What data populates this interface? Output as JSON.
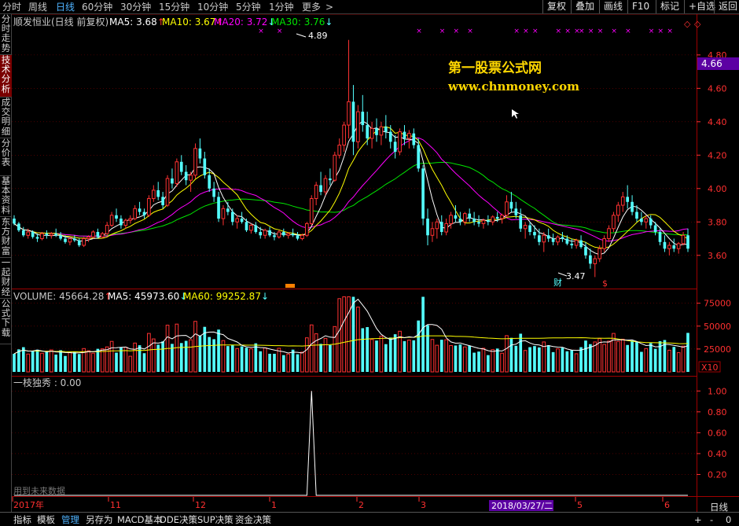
{
  "toolbar": {
    "period_tabs": [
      "分时",
      "周线",
      "日线",
      "60分钟",
      "30分钟",
      "15分钟",
      "10分钟",
      "5分钟",
      "1分钟",
      "更多"
    ],
    "more_arrow": ">",
    "active_period": "日线",
    "right_buttons": [
      "复权",
      "叠加",
      "画线",
      "F10",
      "标记",
      "+自选",
      "返回"
    ]
  },
  "left_tabs": [
    "分时走势",
    "技术分析",
    "成交明细",
    "分价表",
    "基本资料",
    "东方财富",
    "一起财经",
    "公式下载"
  ],
  "active_left_tab": "技术分析",
  "bottom_tabs": [
    "指标",
    "模板",
    "管理",
    "另存为",
    "MACD基本",
    "DDE决策",
    "SUP决策",
    "资金决策"
  ],
  "active_bottom_tab": "管理",
  "bottom_right_buttons": [
    "日线",
    "+",
    "-",
    "0"
  ],
  "watermark": {
    "line1": "第一股票公式网",
    "line2": "www.chnmoney.com"
  },
  "colors": {
    "up": "#ff3232",
    "down": "#54ffff",
    "ma5": "#ffffff",
    "ma10": "#ffff00",
    "ma20": "#ff00ff",
    "ma30": "#00e600",
    "grid": "#7a0000",
    "axis_text": "#ff3030",
    "highlight_label": "#5c00a3",
    "watermark": "#ffd700"
  },
  "main_panel": {
    "title": "顺发恒业(日线 前复权)",
    "ma_values": [
      {
        "name": "MA5",
        "value": "3.68",
        "arrow": "↑"
      },
      {
        "name": "MA10",
        "value": "3.67",
        "arrow": "↑"
      },
      {
        "name": "MA20",
        "value": "3.72",
        "arrow": "↓"
      },
      {
        "name": "MA30",
        "value": "3.76",
        "arrow": "↓"
      }
    ],
    "y_ticks": [
      "4.80",
      "4.60",
      "4.40",
      "4.20",
      "4.00",
      "3.80",
      "3.60"
    ],
    "current_price": "4.66",
    "max_label": "4.89",
    "min_label": "3.47",
    "marker_texts": [
      "财",
      "$"
    ]
  },
  "volume_panel": {
    "title": "VOLUME: 45664.28",
    "title_arrow": "↑",
    "ma5": "MA5: 45973.60",
    "ma5_arrow": "↓",
    "ma60": "MA60: 99252.87",
    "ma60_arrow": "↓",
    "y_ticks": [
      "75000",
      "50000",
      "25000"
    ],
    "multiplier": "X10"
  },
  "indicator_panel": {
    "title": "一枝独秀 : 0.00",
    "y_ticks": [
      "1.00",
      "0.80",
      "0.60",
      "0.40",
      "0.20"
    ],
    "footnote": "用到未来数据"
  },
  "time_axis": {
    "labels": [
      "2017年",
      "11",
      "12",
      "1",
      "2",
      "3",
      "2018/03/27/二",
      "5",
      "6"
    ],
    "highlight": "2018/03/27/二"
  },
  "chart_data": {
    "type": "candlestick",
    "title": "顺发恒业(日线 前复权)",
    "ylim": [
      3.42,
      4.95
    ],
    "bars": [
      [
        3.82,
        3.84,
        3.78,
        3.79
      ],
      [
        3.79,
        3.8,
        3.74,
        3.75
      ],
      [
        3.75,
        3.77,
        3.71,
        3.72
      ],
      [
        3.72,
        3.76,
        3.7,
        3.74
      ],
      [
        3.74,
        3.75,
        3.7,
        3.71
      ],
      [
        3.71,
        3.73,
        3.68,
        3.7
      ],
      [
        3.7,
        3.74,
        3.69,
        3.73
      ],
      [
        3.73,
        3.75,
        3.7,
        3.72
      ],
      [
        3.72,
        3.74,
        3.7,
        3.73
      ],
      [
        3.73,
        3.76,
        3.71,
        3.72
      ],
      [
        3.72,
        3.74,
        3.69,
        3.7
      ],
      [
        3.7,
        3.72,
        3.67,
        3.68
      ],
      [
        3.68,
        3.71,
        3.66,
        3.7
      ],
      [
        3.7,
        3.72,
        3.68,
        3.69
      ],
      [
        3.69,
        3.7,
        3.65,
        3.66
      ],
      [
        3.66,
        3.71,
        3.65,
        3.7
      ],
      [
        3.7,
        3.72,
        3.68,
        3.71
      ],
      [
        3.71,
        3.75,
        3.7,
        3.74
      ],
      [
        3.74,
        3.76,
        3.7,
        3.71
      ],
      [
        3.71,
        3.74,
        3.7,
        3.73
      ],
      [
        3.73,
        3.8,
        3.72,
        3.78
      ],
      [
        3.78,
        3.86,
        3.77,
        3.84
      ],
      [
        3.84,
        3.88,
        3.8,
        3.82
      ],
      [
        3.82,
        3.84,
        3.76,
        3.78
      ],
      [
        3.78,
        3.82,
        3.76,
        3.81
      ],
      [
        3.81,
        3.84,
        3.79,
        3.82
      ],
      [
        3.82,
        3.9,
        3.81,
        3.88
      ],
      [
        3.88,
        3.92,
        3.84,
        3.86
      ],
      [
        3.86,
        3.88,
        3.82,
        3.84
      ],
      [
        3.84,
        3.96,
        3.83,
        3.94
      ],
      [
        3.94,
        4.02,
        3.92,
        3.99
      ],
      [
        3.99,
        4.04,
        3.93,
        3.95
      ],
      [
        3.95,
        3.98,
        3.88,
        3.9
      ],
      [
        3.9,
        4.08,
        3.89,
        4.06
      ],
      [
        4.06,
        4.12,
        4.0,
        4.03
      ],
      [
        4.03,
        4.18,
        4.01,
        4.16
      ],
      [
        4.16,
        4.2,
        4.08,
        4.1
      ],
      [
        4.1,
        4.14,
        4.02,
        4.05
      ],
      [
        4.05,
        4.1,
        3.98,
        4.08
      ],
      [
        4.08,
        4.27,
        4.06,
        4.24
      ],
      [
        4.24,
        4.3,
        4.15,
        4.18
      ],
      [
        4.18,
        4.22,
        4.06,
        4.08
      ],
      [
        4.08,
        4.12,
        3.98,
        4.0
      ],
      [
        4.0,
        4.04,
        3.92,
        3.95
      ],
      [
        3.95,
        3.98,
        3.8,
        3.82
      ],
      [
        3.82,
        3.9,
        3.78,
        3.88
      ],
      [
        3.88,
        3.92,
        3.84,
        3.86
      ],
      [
        3.86,
        3.88,
        3.78,
        3.8
      ],
      [
        3.8,
        3.84,
        3.76,
        3.82
      ],
      [
        3.82,
        3.86,
        3.79,
        3.8
      ],
      [
        3.8,
        3.82,
        3.74,
        3.75
      ],
      [
        3.75,
        3.79,
        3.73,
        3.78
      ],
      [
        3.78,
        3.8,
        3.73,
        3.74
      ],
      [
        3.74,
        3.77,
        3.7,
        3.72
      ],
      [
        3.72,
        3.76,
        3.7,
        3.75
      ],
      [
        3.75,
        3.77,
        3.71,
        3.72
      ],
      [
        3.72,
        3.74,
        3.69,
        3.71
      ],
      [
        3.71,
        3.75,
        3.7,
        3.74
      ],
      [
        3.74,
        3.76,
        3.71,
        3.72
      ],
      [
        3.72,
        3.74,
        3.7,
        3.73
      ],
      [
        3.73,
        3.76,
        3.71,
        3.72
      ],
      [
        3.72,
        3.74,
        3.69,
        3.7
      ],
      [
        3.7,
        3.73,
        3.69,
        3.72
      ],
      [
        3.72,
        3.8,
        3.71,
        3.79
      ],
      [
        3.79,
        3.96,
        3.78,
        3.94
      ],
      [
        3.94,
        4.04,
        3.9,
        4.02
      ],
      [
        4.02,
        4.1,
        3.96,
        3.98
      ],
      [
        3.98,
        4.08,
        3.96,
        4.06
      ],
      [
        4.06,
        4.12,
        4.02,
        4.05
      ],
      [
        4.05,
        4.22,
        4.04,
        4.2
      ],
      [
        4.2,
        4.3,
        4.18,
        4.26
      ],
      [
        4.26,
        4.4,
        4.22,
        4.38
      ],
      [
        4.38,
        4.89,
        4.3,
        4.52
      ],
      [
        4.52,
        4.62,
        4.2,
        4.28
      ],
      [
        4.28,
        4.5,
        4.24,
        4.46
      ],
      [
        4.46,
        4.56,
        4.34,
        4.38
      ],
      [
        4.38,
        4.46,
        4.26,
        4.3
      ],
      [
        4.3,
        4.4,
        4.24,
        4.36
      ],
      [
        4.36,
        4.42,
        4.28,
        4.32
      ],
      [
        4.32,
        4.4,
        4.26,
        4.37
      ],
      [
        4.37,
        4.44,
        4.3,
        4.34
      ],
      [
        4.34,
        4.38,
        4.24,
        4.28
      ],
      [
        4.28,
        4.32,
        4.18,
        4.22
      ],
      [
        4.22,
        4.36,
        4.2,
        4.34
      ],
      [
        4.34,
        4.38,
        4.26,
        4.3
      ],
      [
        4.3,
        4.35,
        4.24,
        4.33
      ],
      [
        4.33,
        4.36,
        4.24,
        4.26
      ],
      [
        4.26,
        4.3,
        4.1,
        4.12
      ],
      [
        4.12,
        4.14,
        3.78,
        3.82
      ],
      [
        3.82,
        3.88,
        3.66,
        3.72
      ],
      [
        3.72,
        3.8,
        3.68,
        3.76
      ],
      [
        3.76,
        3.82,
        3.7,
        3.8
      ],
      [
        3.8,
        3.84,
        3.72,
        3.74
      ],
      [
        3.74,
        3.82,
        3.72,
        3.79
      ],
      [
        3.79,
        3.86,
        3.76,
        3.84
      ],
      [
        3.84,
        3.9,
        3.8,
        3.82
      ],
      [
        3.82,
        3.86,
        3.78,
        3.8
      ],
      [
        3.8,
        3.86,
        3.78,
        3.85
      ],
      [
        3.85,
        3.88,
        3.8,
        3.82
      ],
      [
        3.82,
        3.86,
        3.78,
        3.8
      ],
      [
        3.8,
        3.84,
        3.77,
        3.79
      ],
      [
        3.79,
        3.82,
        3.76,
        3.81
      ],
      [
        3.81,
        3.84,
        3.78,
        3.8
      ],
      [
        3.8,
        3.84,
        3.78,
        3.83
      ],
      [
        3.83,
        3.86,
        3.8,
        3.82
      ],
      [
        3.82,
        3.85,
        3.79,
        3.84
      ],
      [
        3.84,
        3.96,
        3.83,
        3.92
      ],
      [
        3.92,
        3.98,
        3.86,
        3.88
      ],
      [
        3.88,
        3.92,
        3.82,
        3.84
      ],
      [
        3.84,
        3.88,
        3.74,
        3.76
      ],
      [
        3.76,
        3.8,
        3.7,
        3.78
      ],
      [
        3.78,
        3.8,
        3.72,
        3.74
      ],
      [
        3.74,
        3.78,
        3.7,
        3.72
      ],
      [
        3.72,
        3.76,
        3.66,
        3.68
      ],
      [
        3.68,
        3.74,
        3.62,
        3.72
      ],
      [
        3.72,
        3.76,
        3.68,
        3.7
      ],
      [
        3.7,
        3.73,
        3.66,
        3.68
      ],
      [
        3.68,
        3.72,
        3.66,
        3.71
      ],
      [
        3.71,
        3.74,
        3.68,
        3.7
      ],
      [
        3.7,
        3.72,
        3.66,
        3.67
      ],
      [
        3.67,
        3.7,
        3.64,
        3.66
      ],
      [
        3.66,
        3.7,
        3.64,
        3.69
      ],
      [
        3.69,
        3.72,
        3.64,
        3.65
      ],
      [
        3.65,
        3.68,
        3.58,
        3.6
      ],
      [
        3.6,
        3.64,
        3.52,
        3.55
      ],
      [
        3.55,
        3.6,
        3.47,
        3.58
      ],
      [
        3.58,
        3.66,
        3.56,
        3.64
      ],
      [
        3.64,
        3.72,
        3.62,
        3.7
      ],
      [
        3.7,
        3.78,
        3.68,
        3.76
      ],
      [
        3.76,
        3.86,
        3.74,
        3.84
      ],
      [
        3.84,
        3.92,
        3.8,
        3.9
      ],
      [
        3.9,
        3.98,
        3.86,
        3.95
      ],
      [
        3.95,
        4.02,
        3.88,
        3.92
      ],
      [
        3.92,
        3.96,
        3.84,
        3.86
      ],
      [
        3.86,
        3.9,
        3.8,
        3.82
      ],
      [
        3.82,
        3.86,
        3.78,
        3.8
      ],
      [
        3.8,
        3.84,
        3.76,
        3.82
      ],
      [
        3.82,
        3.84,
        3.76,
        3.78
      ],
      [
        3.78,
        3.8,
        3.72,
        3.74
      ],
      [
        3.74,
        3.76,
        3.66,
        3.68
      ],
      [
        3.68,
        3.72,
        3.62,
        3.64
      ],
      [
        3.64,
        3.68,
        3.6,
        3.66
      ],
      [
        3.66,
        3.7,
        3.62,
        3.64
      ],
      [
        3.64,
        3.68,
        3.61,
        3.67
      ],
      [
        3.67,
        3.74,
        3.66,
        3.72
      ],
      [
        3.72,
        3.76,
        3.62,
        3.64
      ]
    ],
    "volume_scale_max": 85000,
    "volume_ticks": [
      25000,
      50000,
      75000
    ],
    "indicator_spike": {
      "value": 1.0,
      "bar_index": 64
    },
    "indicator_ylim": [
      0,
      1.1
    ],
    "indicator_ticks": [
      0.2,
      0.4,
      0.6,
      0.8,
      1.0
    ],
    "top_marks_count": 24
  }
}
